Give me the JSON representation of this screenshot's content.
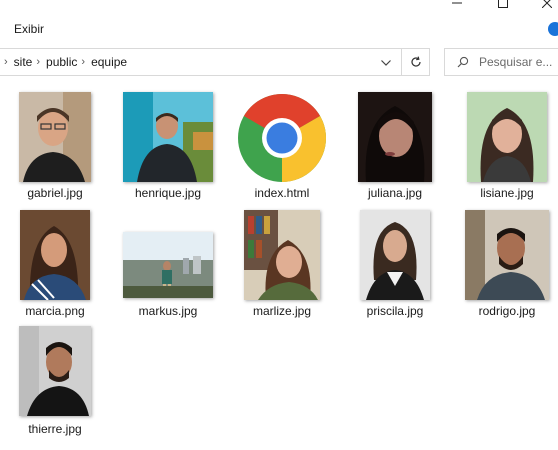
{
  "menu": {
    "view_label": "Exibir"
  },
  "window_controls": [
    "minimize",
    "maximize",
    "close"
  ],
  "address_bar": {
    "segments": [
      "site",
      "public",
      "equipe"
    ]
  },
  "search": {
    "placeholder": "Pesquisar e..."
  },
  "files": [
    {
      "name": "gabriel.jpg",
      "kind": "photo"
    },
    {
      "name": "henrique.jpg",
      "kind": "photo"
    },
    {
      "name": "index.html",
      "kind": "chrome-html"
    },
    {
      "name": "juliana.jpg",
      "kind": "photo"
    },
    {
      "name": "lisiane.jpg",
      "kind": "photo"
    },
    {
      "name": "marcia.png",
      "kind": "photo"
    },
    {
      "name": "markus.jpg",
      "kind": "photo"
    },
    {
      "name": "marlize.jpg",
      "kind": "photo"
    },
    {
      "name": "priscila.jpg",
      "kind": "photo"
    },
    {
      "name": "rodrigo.jpg",
      "kind": "photo"
    },
    {
      "name": "thierre.jpg",
      "kind": "photo"
    }
  ],
  "colors": {
    "accent": "#1a73d9",
    "border": "#d9d9d9"
  }
}
